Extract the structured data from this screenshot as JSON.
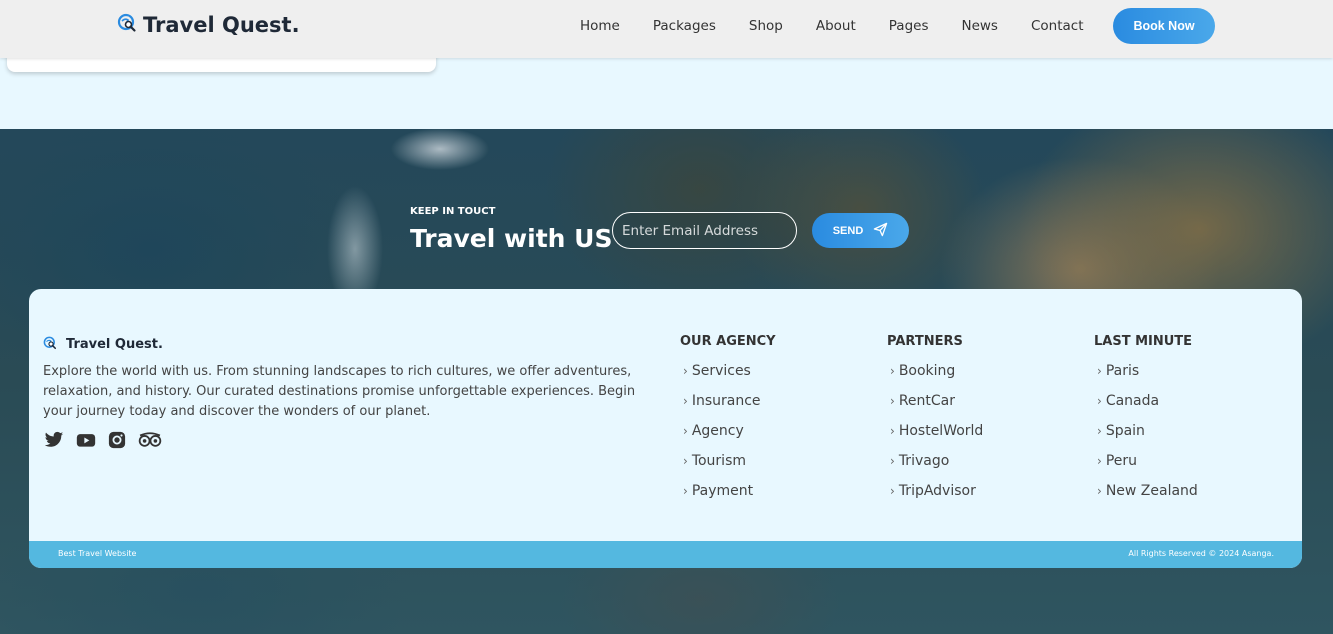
{
  "header": {
    "brand": "Travel Quest.",
    "nav": [
      "Home",
      "Packages",
      "Shop",
      "About",
      "Pages",
      "News",
      "Contact"
    ],
    "cta": "Book Now"
  },
  "newsletter": {
    "eyebrow": "KEEP IN TOUCT",
    "title": "Travel with US",
    "email_placeholder": "Enter Email Address",
    "send_label": "SEND"
  },
  "footer": {
    "brand": "Travel Quest.",
    "description": "Explore the world with us. From stunning landscapes to rich cultures, we offer adventures, relaxation, and history. Our curated destinations promise unforgettable experiences. Begin your journey today and discover the wonders of our planet.",
    "socials": [
      "twitter-icon",
      "youtube-icon",
      "instagram-icon",
      "tripadvisor-icon"
    ],
    "columns": [
      {
        "title": "OUR AGENCY",
        "items": [
          "Services",
          "Insurance",
          "Agency",
          "Tourism",
          "Payment"
        ]
      },
      {
        "title": "PARTNERS",
        "items": [
          "Booking",
          "RentCar",
          "HostelWorld",
          "Trivago",
          "TripAdvisor"
        ]
      },
      {
        "title": "LAST MINUTE",
        "items": [
          "Paris",
          "Canada",
          "Spain",
          "Peru",
          "New Zealand"
        ]
      }
    ],
    "bottom_left": "Best Travel Website",
    "bottom_right": "All Rights Reserved © 2024 Asanga."
  },
  "colors": {
    "accent": "#2a8be0",
    "bottom_bar": "#54b8e0",
    "light_bg": "#e8f8ff"
  }
}
